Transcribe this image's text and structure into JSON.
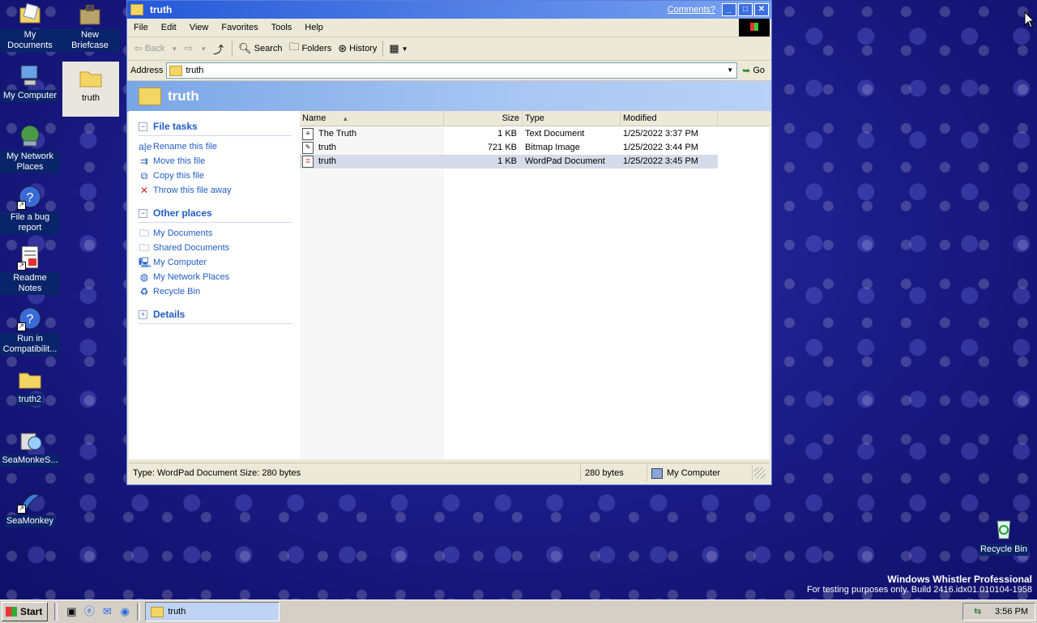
{
  "desktop": {
    "icons": [
      {
        "label": "My Documents",
        "icon": "my-documents-icon"
      },
      {
        "label": "New Briefcase",
        "icon": "briefcase-icon"
      },
      {
        "label": "My Computer",
        "icon": "my-computer-icon"
      },
      {
        "label": "truth",
        "icon": "folder-icon"
      },
      {
        "label": "My Network Places",
        "icon": "network-places-icon"
      },
      {
        "label": "File a bug report",
        "icon": "help-icon"
      },
      {
        "label": "Readme Notes",
        "icon": "readme-icon"
      },
      {
        "label": "Run in Compatibilit...",
        "icon": "help-icon"
      },
      {
        "label": "truth2",
        "icon": "folder-icon"
      },
      {
        "label": "SeaMonkeS...",
        "icon": "seamonkey-setup-icon"
      },
      {
        "label": "SeaMonkey",
        "icon": "seamonkey-icon"
      },
      {
        "label": "Recycle Bin",
        "icon": "recycle-bin-icon"
      }
    ],
    "watermark": {
      "line1": "Windows Whistler Professional",
      "line2": "For testing purposes only. Build 2416.idx01.010104-1958"
    }
  },
  "window": {
    "title": "truth",
    "comments_link": "Comments?",
    "controls": {
      "minimize": "_",
      "maximize": "□",
      "close": "✕"
    },
    "menu": [
      "File",
      "Edit",
      "View",
      "Favorites",
      "Tools",
      "Help"
    ],
    "toolbar": {
      "back": "Back",
      "search": "Search",
      "folders": "Folders",
      "history": "History"
    },
    "address": {
      "label": "Address",
      "value": "truth",
      "go": "Go"
    },
    "header_title": "truth",
    "task_pane": {
      "file_tasks": {
        "title": "File tasks",
        "items": [
          "Rename this file",
          "Move this file",
          "Copy this file",
          "Throw this file away"
        ]
      },
      "other_places": {
        "title": "Other places",
        "items": [
          "My Documents",
          "Shared Documents",
          "My Computer",
          "My Network Places",
          "Recycle Bin"
        ]
      },
      "details": {
        "title": "Details"
      }
    },
    "columns": {
      "name": "Name",
      "size": "Size",
      "type": "Type",
      "modified": "Modified"
    },
    "files": [
      {
        "name": "The Truth",
        "size": "1 KB",
        "type": "Text Document",
        "modified": "1/25/2022 3:37 PM",
        "selected": false
      },
      {
        "name": "truth",
        "size": "721 KB",
        "type": "Bitmap Image",
        "modified": "1/25/2022 3:44 PM",
        "selected": false
      },
      {
        "name": "truth",
        "size": "1 KB",
        "type": "WordPad Document",
        "modified": "1/25/2022 3:45 PM",
        "selected": true
      }
    ],
    "status": {
      "main": "Type: WordPad Document Size: 280 bytes",
      "size": "280 bytes",
      "zone": "My Computer"
    }
  },
  "taskbar": {
    "start": "Start",
    "task_button": "truth",
    "clock": "3:56 PM"
  }
}
